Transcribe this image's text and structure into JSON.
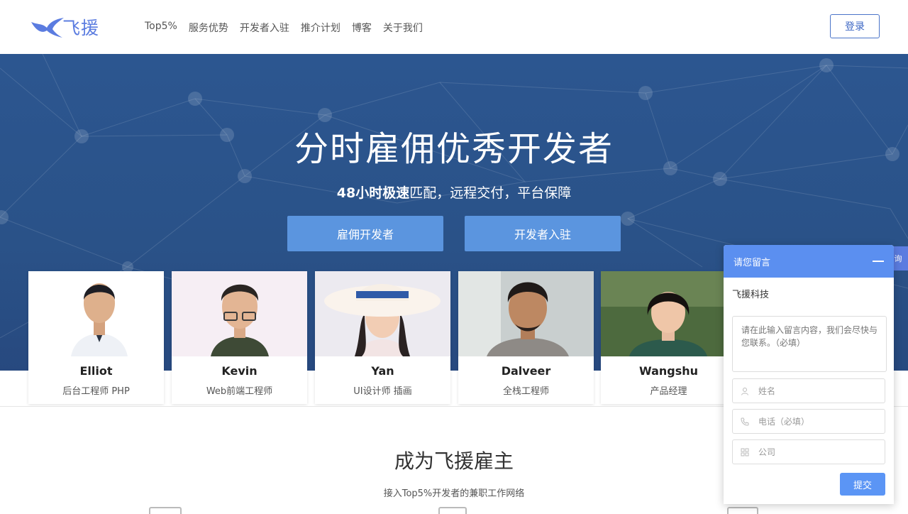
{
  "header": {
    "logo_text": "飞援",
    "nav": [
      "Top5%",
      "服务优势",
      "开发者入驻",
      "推介计划",
      "博客",
      "关于我们"
    ],
    "login_label": "登录"
  },
  "hero": {
    "title": "分时雇佣优秀开发者",
    "subtitle_bold": "48小时极速",
    "subtitle_rest": "匹配，远程交付，平台保障",
    "hire_button": "雇佣开发者",
    "join_button": "开发者入驻"
  },
  "developers": [
    {
      "name": "Elliot",
      "role": "后台工程师 PHP"
    },
    {
      "name": "Kevin",
      "role": "Web前端工程师"
    },
    {
      "name": "Yan",
      "role": "UI设计师 插画"
    },
    {
      "name": "Dalveer",
      "role": "全栈工程师"
    },
    {
      "name": "Wangshu",
      "role": "产品经理"
    }
  ],
  "employer": {
    "title": "成为飞援雇主",
    "subtitle": "接入Top5%开发者的兼职工作网络"
  },
  "side_tab": {
    "label": "询"
  },
  "widget": {
    "title": "请您留言",
    "company": "飞援科技",
    "message_placeholder": "请在此输入留言内容，我们会尽快与您联系。（必填）",
    "name_placeholder": "姓名",
    "phone_placeholder": "电话（必填）",
    "company_placeholder": "公司",
    "submit_label": "提交"
  },
  "colors": {
    "brand": "#5b7ce0",
    "hero_bg": "#2a5288",
    "button_blue": "#5b95df",
    "widget_header": "#5b8ff0"
  }
}
